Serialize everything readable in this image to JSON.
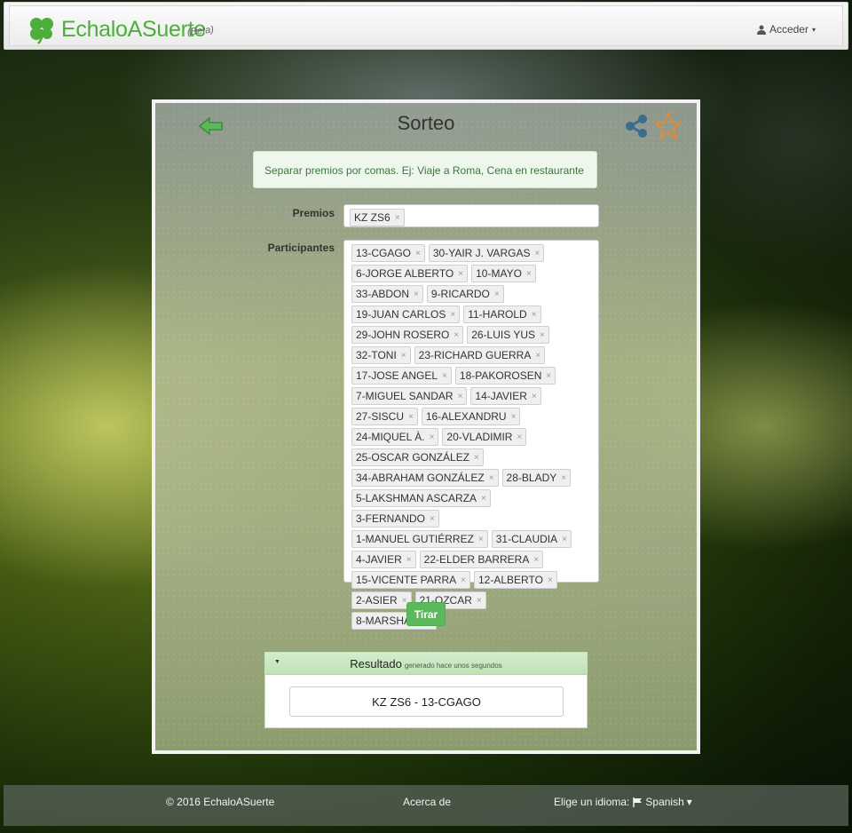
{
  "navbar": {
    "brand_name": "EchaloASuerte",
    "brand_beta": "(Beta)",
    "login_label": "Acceder",
    "login_caret": "▾",
    "user_icon": "user-icon"
  },
  "page": {
    "title": "Sorteo",
    "back_icon": "back-arrow-icon",
    "share_icon": "share-icon",
    "favorite_icon": "star-icon"
  },
  "form": {
    "hint": "Separar premios por comas. Ej: Viaje a Roma, Cena en restaurante",
    "prizes_label": "Premios",
    "prizes": [
      "KZ ZS6"
    ],
    "participants_label": "Participantes",
    "participants": [
      "13-CGAGO",
      "30-YAIR J. VARGAS",
      "6-JORGE ALBERTO",
      "10-MAYO",
      "33-ABDON",
      "9-RICARDO",
      "19-JUAN CARLOS",
      "11-HAROLD",
      "29-JOHN ROSERO",
      "26-LUIS YUS",
      "32-TONI",
      "23-RICHARD GUERRA",
      "17-JOSE ANGEL",
      "18-PAKOROSEN",
      "7-MIGUEL SANDAR",
      "14-JAVIER",
      "27-SISCU",
      "16-ALEXANDRU",
      "24-MIQUEL À.",
      "20-VLADIMIR",
      "25-OSCAR GONZÁLEZ",
      "34-ABRAHAM GONZÁLEZ",
      "28-BLADY",
      "5-LAKSHMAN ASCARZA",
      "3-FERNANDO",
      "1-MANUEL GUTIÉRREZ",
      "31-CLAUDIA",
      "4-JAVIER",
      "22-ELDER BARRERA",
      "15-VICENTE PARRA",
      "12-ALBERTO",
      "2-ASIER",
      "21-OZCAR",
      "8-MARSHALL"
    ],
    "remove_glyph": "×",
    "submit_label": "Tirar"
  },
  "result": {
    "title": "Resultado",
    "subtitle": "generado hace unos segundos",
    "caret": "▼",
    "value": "KZ ZS6 - 13-CGAGO"
  },
  "footer": {
    "copyright": "© 2016 EchaloASuerte",
    "about": "Acerca de",
    "language_label": "Elige un idioma:",
    "language_value": "Spanish",
    "language_caret": "▾",
    "flag_icon": "flag-icon"
  },
  "colors": {
    "brand_green": "#4caf3b",
    "button_green": "#5cb85c",
    "share_blue": "#3a6e8f",
    "star_orange": "#e08a3c"
  }
}
